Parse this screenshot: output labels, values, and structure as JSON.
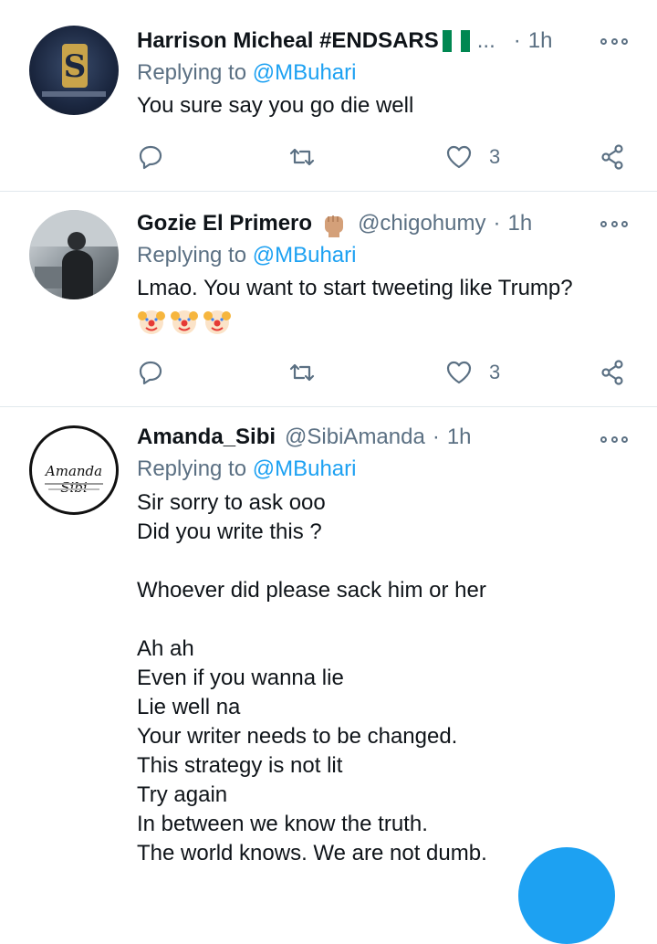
{
  "tweets": [
    {
      "name": "Harrison Micheal #ENDSARS",
      "handle": "",
      "ellipsis": "...",
      "dot": "·",
      "time": "1h",
      "replying_prefix": "Replying to ",
      "replying_to": "@MBuhari",
      "text": "You sure say you go die well",
      "like_count": "3",
      "flag_colors": [
        "#008751",
        "#ffffff",
        "#008751"
      ]
    },
    {
      "name": "Gozie El Primero",
      "handle": "@chigohumy",
      "dot": "·",
      "time": "1h",
      "replying_prefix": "Replying to ",
      "replying_to": "@MBuhari",
      "text": "Lmao. You want to start tweeting like Trump?",
      "emoji": [
        "clown-face",
        "clown-face",
        "clown-face"
      ],
      "like_count": "3"
    },
    {
      "name": "Amanda_Sibi",
      "handle": "@SibiAmanda",
      "dot": "·",
      "time": "1h",
      "replying_prefix": "Replying to ",
      "replying_to": "@MBuhari",
      "avatar_text": "Amanda Sibi",
      "text": "Sir sorry to ask ooo\nDid you write this ?\n\nWhoever did please sack him or her\n\nAh ah\nEven if you wanna lie\nLie well na\nYour writer needs to be changed.\nThis strategy is not lit\nTry again\nIn between we know the truth.\nThe world knows. We are not dumb."
    }
  ],
  "colors": {
    "accent": "#1da1f2",
    "secondary_text": "#5b7083",
    "divider": "#e1e8ed"
  }
}
